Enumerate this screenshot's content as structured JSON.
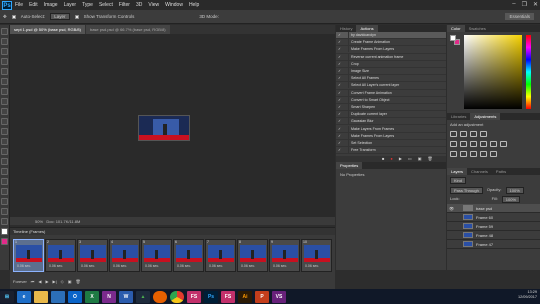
{
  "app": {
    "logo": "Ps"
  },
  "menu": [
    "File",
    "Edit",
    "Image",
    "Layer",
    "Type",
    "Select",
    "Filter",
    "3D",
    "View",
    "Window",
    "Help"
  ],
  "window_controls": [
    "–",
    "❐",
    "✕"
  ],
  "options": {
    "auto_select": "Auto-Select:",
    "auto_select_value": "Layer",
    "transform": "Show Transform Controls",
    "mode_3d": "3D Mode:",
    "workspace": "Essentials"
  },
  "tabs": [
    "sept 1.psd @ 50% (base psd, RGB/8)",
    "base psd.psd @ 66.7% (base psd, RGB/8)"
  ],
  "status": {
    "zoom": "50%",
    "doc": "Doc: 101.7K/11.8M"
  },
  "timeline": {
    "title": "Timeline (Frames)",
    "frames": [
      {
        "num": "1",
        "dur": "0.06 sec."
      },
      {
        "num": "2",
        "dur": "0.06 sec."
      },
      {
        "num": "3",
        "dur": "0.06 sec."
      },
      {
        "num": "4",
        "dur": "0.06 sec."
      },
      {
        "num": "5",
        "dur": "0.06 sec."
      },
      {
        "num": "6",
        "dur": "0.06 sec."
      },
      {
        "num": "7",
        "dur": "0.06 sec."
      },
      {
        "num": "8",
        "dur": "0.06 sec."
      },
      {
        "num": "9",
        "dur": "0.06 sec."
      },
      {
        "num": "10",
        "dur": "0.06 sec."
      }
    ],
    "loop": "Forever"
  },
  "dock": {
    "tabs": [
      "History",
      "Actions"
    ],
    "actions": [
      {
        "label": "by davidcarolyn",
        "hl": true
      },
      {
        "label": "Create Frame Animation"
      },
      {
        "label": "Make Frames From Layers"
      },
      {
        "label": "Reverse current animation frame"
      },
      {
        "label": "Crop"
      },
      {
        "label": "Image Size"
      },
      {
        "label": "Select All Frames"
      },
      {
        "label": "Select All Layer's current layer"
      },
      {
        "label": "Convert Frame Animation"
      },
      {
        "label": "Convert to Smart Object"
      },
      {
        "label": "Smart Sharpen"
      },
      {
        "label": "Duplicate current layer"
      },
      {
        "label": "Gaussian Blur"
      },
      {
        "label": "Make Layers From Frames"
      },
      {
        "label": "Make Frames From Layers"
      },
      {
        "label": "Set Selection"
      },
      {
        "label": "Free Transform"
      }
    ],
    "props_title": "Properties",
    "props_body": "No Properties"
  },
  "color": {
    "tabs": [
      "Color",
      "Swatches"
    ],
    "fg": "#ffffff",
    "bg": "#e12b8a"
  },
  "adjustments": {
    "tabs": [
      "Libraries",
      "Adjustments"
    ],
    "title": "Add an adjustment"
  },
  "layers": {
    "tabs": [
      "Layers",
      "Channels",
      "Paths"
    ],
    "kind": "Kind",
    "blend": "Pass Through",
    "opacity_label": "Opacity:",
    "opacity": "100%",
    "lock": "Lock:",
    "fill_label": "Fill:",
    "fill": "100%",
    "rows": [
      {
        "name": "base psd",
        "grp": true
      },
      {
        "name": "Frame 60"
      },
      {
        "name": "Frame 59"
      },
      {
        "name": "Frame 48"
      },
      {
        "name": "Frame 47"
      }
    ]
  },
  "taskbar": {
    "time": "13:29",
    "date": "12/09/2017",
    "apps": [
      {
        "icon": "windows-icon",
        "label": "",
        "color": "#1a1f2e"
      },
      {
        "icon": "ie-icon",
        "label": "e",
        "color": "#1e6ec8"
      },
      {
        "icon": "folder-icon",
        "label": "",
        "color": "#e8b84a"
      },
      {
        "icon": "store-icon",
        "label": "",
        "color": "#2c6fb8"
      },
      {
        "icon": "outlook-icon",
        "label": "O",
        "color": "#0a64c8"
      },
      {
        "icon": "excel-icon",
        "label": "X",
        "color": "#1e7a44"
      },
      {
        "icon": "onenote-icon",
        "label": "N",
        "color": "#7a2a8c"
      },
      {
        "icon": "word-icon",
        "label": "W",
        "color": "#2b5cad"
      },
      {
        "icon": "drive-icon",
        "label": "▲",
        "color": "#1e2b3c"
      },
      {
        "icon": "firefox-icon",
        "label": "",
        "color": "#e66000"
      },
      {
        "icon": "chrome-icon",
        "label": "",
        "color": "#e33b2e"
      },
      {
        "icon": "fs-icon",
        "label": "FS",
        "color": "#c2306b"
      },
      {
        "icon": "photoshop-icon",
        "label": "Ps",
        "color": "#001e36"
      },
      {
        "icon": "fs2-icon",
        "label": "FS",
        "color": "#c2306b"
      },
      {
        "icon": "illustrator-icon",
        "label": "Ai",
        "color": "#2b1a05"
      },
      {
        "icon": "powerpoint-icon",
        "label": "P",
        "color": "#c43e1c"
      },
      {
        "icon": "visualstudio-icon",
        "label": "VS",
        "color": "#68217a"
      }
    ]
  }
}
